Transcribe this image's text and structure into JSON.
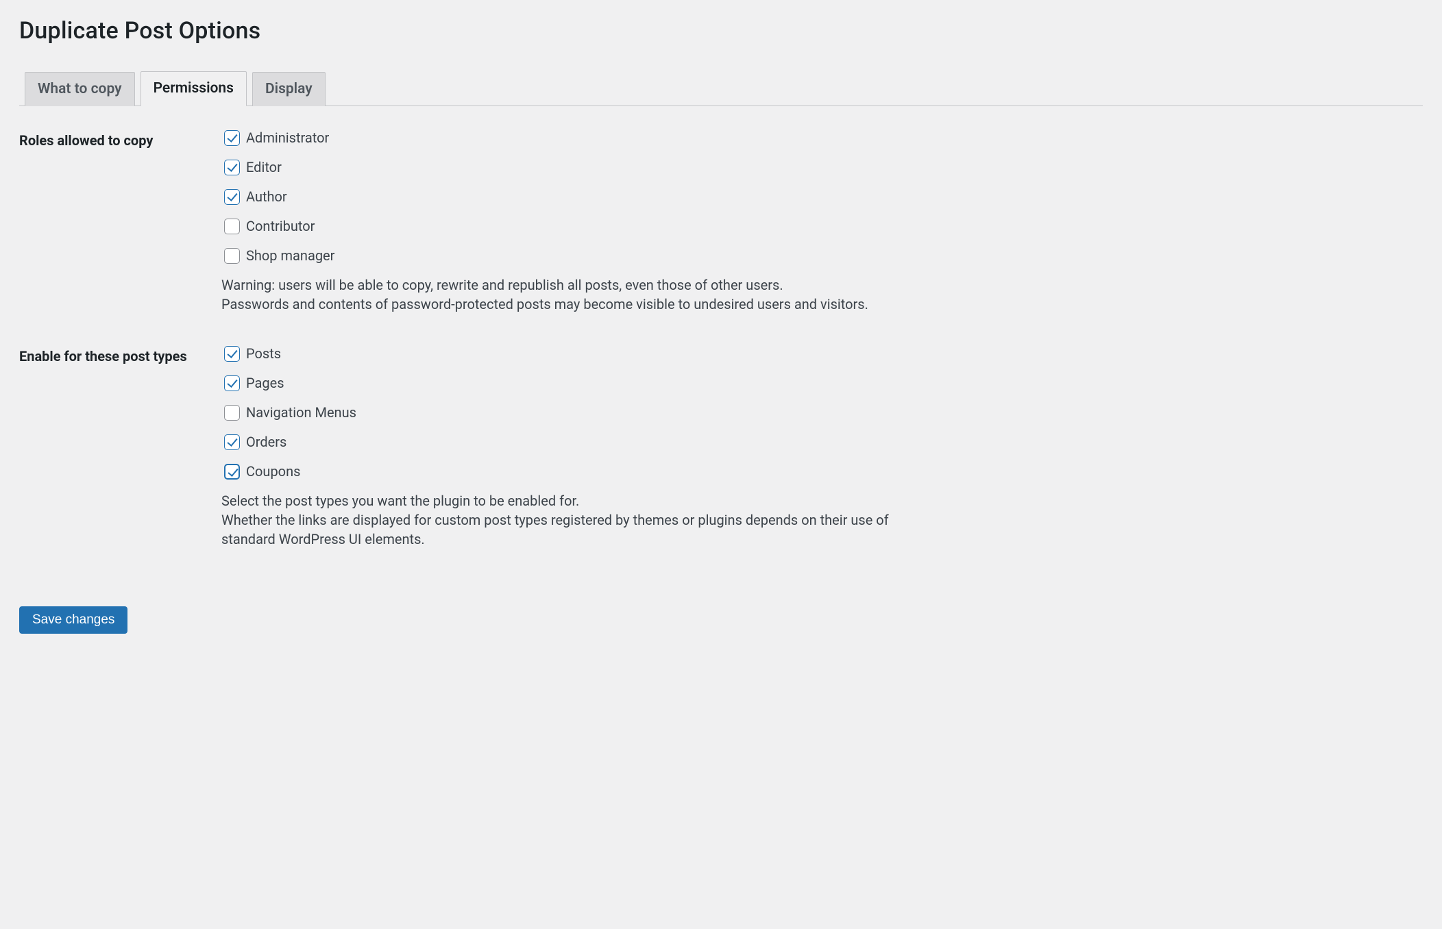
{
  "page_title": "Duplicate Post Options",
  "tabs": [
    {
      "id": "what-to-copy",
      "label": "What to copy",
      "active": false
    },
    {
      "id": "permissions",
      "label": "Permissions",
      "active": true
    },
    {
      "id": "display",
      "label": "Display",
      "active": false
    }
  ],
  "sections": {
    "roles": {
      "heading": "Roles allowed to copy",
      "options": [
        {
          "id": "administrator",
          "label": "Administrator",
          "checked": true,
          "focused": false
        },
        {
          "id": "editor",
          "label": "Editor",
          "checked": true,
          "focused": false
        },
        {
          "id": "author",
          "label": "Author",
          "checked": true,
          "focused": false
        },
        {
          "id": "contributor",
          "label": "Contributor",
          "checked": false,
          "focused": false
        },
        {
          "id": "shop_manager",
          "label": "Shop manager",
          "checked": false,
          "focused": false
        }
      ],
      "description_line1": "Warning: users will be able to copy, rewrite and republish all posts, even those of other users.",
      "description_line2": "Passwords and contents of password-protected posts may become visible to undesired users and visitors."
    },
    "post_types": {
      "heading": "Enable for these post types",
      "options": [
        {
          "id": "post",
          "label": "Posts",
          "checked": true,
          "focused": false
        },
        {
          "id": "page",
          "label": "Pages",
          "checked": true,
          "focused": false
        },
        {
          "id": "nav_menu",
          "label": "Navigation Menus",
          "checked": false,
          "focused": false
        },
        {
          "id": "orders",
          "label": "Orders",
          "checked": true,
          "focused": false
        },
        {
          "id": "coupons",
          "label": "Coupons",
          "checked": true,
          "focused": true
        }
      ],
      "description_line1": "Select the post types you want the plugin to be enabled for.",
      "description_line2": "Whether the links are displayed for custom post types registered by themes or plugins depends on their use of standard WordPress UI elements."
    }
  },
  "submit_label": "Save changes"
}
